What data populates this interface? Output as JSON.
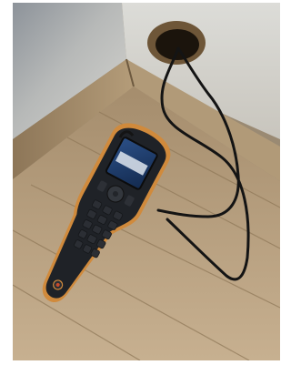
{
  "scene": {
    "subject": "handheld-moisture-meter",
    "objects": [
      "wall",
      "skirting-board",
      "wooden-floor",
      "wall-hole",
      "probe-cable",
      "meter-body",
      "meter-screen",
      "keypad",
      "power-button"
    ]
  },
  "meter": {
    "screen": {
      "top_readout": "",
      "main_readout": "",
      "bottom_readout": ""
    },
    "keys": {
      "nav": "nav-pad",
      "power": "power"
    }
  },
  "colors": {
    "wall": "#c5c5c1",
    "floor": "#b69f7f",
    "skirting": "#a08a6c",
    "meter_body": "#1f2227",
    "meter_trim": "#d08a3c",
    "screen": "#1f3b68",
    "cable": "#141414"
  }
}
